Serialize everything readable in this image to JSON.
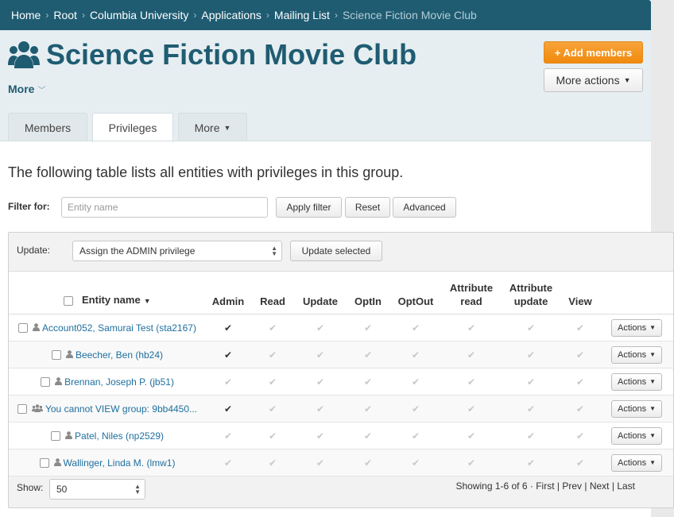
{
  "breadcrumb": [
    {
      "label": "Home"
    },
    {
      "label": "Root"
    },
    {
      "label": "Columbia University"
    },
    {
      "label": "Applications"
    },
    {
      "label": "Mailing List"
    },
    {
      "label": "Science Fiction Movie Club"
    }
  ],
  "header": {
    "title": "Science Fiction Movie Club",
    "more_label": "More",
    "add_members_label": "+ Add members",
    "more_actions_label": "More actions"
  },
  "tabs": [
    {
      "label": "Members"
    },
    {
      "label": "Privileges"
    },
    {
      "label": "More"
    }
  ],
  "intro": "The following table lists all entities with privileges in this group.",
  "filter": {
    "label": "Filter for:",
    "placeholder": "Entity name",
    "apply_label": "Apply filter",
    "reset_label": "Reset",
    "advanced_label": "Advanced"
  },
  "update": {
    "label": "Update:",
    "selected_option": "Assign the ADMIN privilege",
    "button_label": "Update selected"
  },
  "table": {
    "columns": [
      "Entity name",
      "Admin",
      "Read",
      "Update",
      "OptIn",
      "OptOut",
      "Attribute read",
      "Attribute update",
      "View"
    ],
    "actions_label": "Actions",
    "rows": [
      {
        "name": "Account052, Samurai Test (sta2167)",
        "type": "person",
        "admin": true
      },
      {
        "name": "Beecher, Ben (hb24)",
        "type": "person",
        "admin": true
      },
      {
        "name": "Brennan, Joseph P. (jb51)",
        "type": "person",
        "admin": false
      },
      {
        "name": "You cannot VIEW group: 9bb4450...",
        "type": "group",
        "admin": true
      },
      {
        "name": "Patel, Niles (np2529)",
        "type": "person",
        "admin": false
      },
      {
        "name": "Wallinger, Linda M. (lmw1)",
        "type": "person",
        "admin": false
      }
    ]
  },
  "footer": {
    "show_label": "Show:",
    "page_size": "50",
    "showing": "Showing 1-6 of 6",
    "pager": [
      "First",
      "Prev",
      "Next",
      "Last"
    ]
  },
  "colors": {
    "brand": "#1f5c72",
    "accent": "#f08a0c",
    "link": "#1f6f9e"
  }
}
